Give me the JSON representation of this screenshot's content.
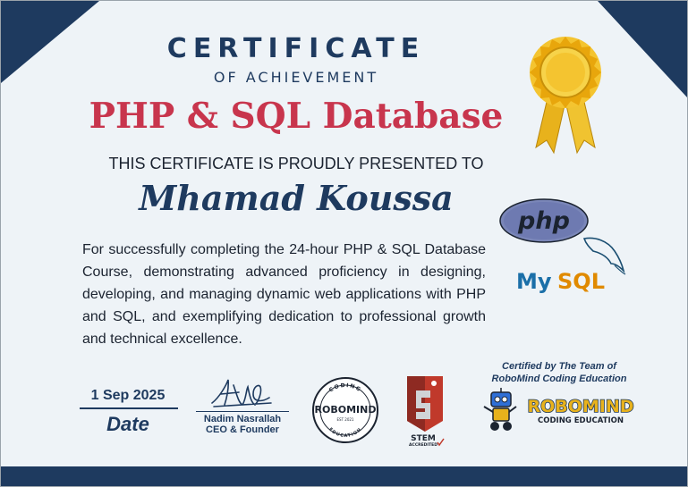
{
  "certificate": {
    "title": "CERTIFICATE",
    "subtitle": "OF ACHIEVEMENT",
    "course": "PHP & SQL Database",
    "presented_to": "THIS CERTIFICATE IS PROUDLY PRESENTED TO",
    "recipient": "Mhamad Koussa",
    "description": "For successfully completing the 24-hour PHP & SQL Database Course, demonstrating advanced proficiency in designing, developing, and managing dynamic web applications with PHP and SQL, and exemplifying dedication to professional growth and technical excellence."
  },
  "footer": {
    "date_value": "1 Sep 2025",
    "date_label": "Date",
    "signer_name": "Nadim Nasrallah",
    "signer_title": "CEO & Founder",
    "certified_by_line1": "Certified by The Team of",
    "certified_by_line2": "RoboMind Coding Education"
  },
  "logos": {
    "seal_name": "ROBOMIND",
    "seal_top_text": "CODING",
    "seal_bottom_text": "EDUCATION",
    "seal_est": "EST 2021",
    "stem_text": "STEM",
    "stem_accredited": "ACCREDITED",
    "robomind_wordmark": "ROBOMIND",
    "robomind_tagline": "CODING EDUCATION",
    "php_text": "php",
    "mysql_text_my": "My",
    "mysql_text_sql": "SQL"
  },
  "colors": {
    "navy": "#1e3a5f",
    "crimson": "#c8354d",
    "background": "#eef3f7",
    "gold": "#e8b21c"
  }
}
